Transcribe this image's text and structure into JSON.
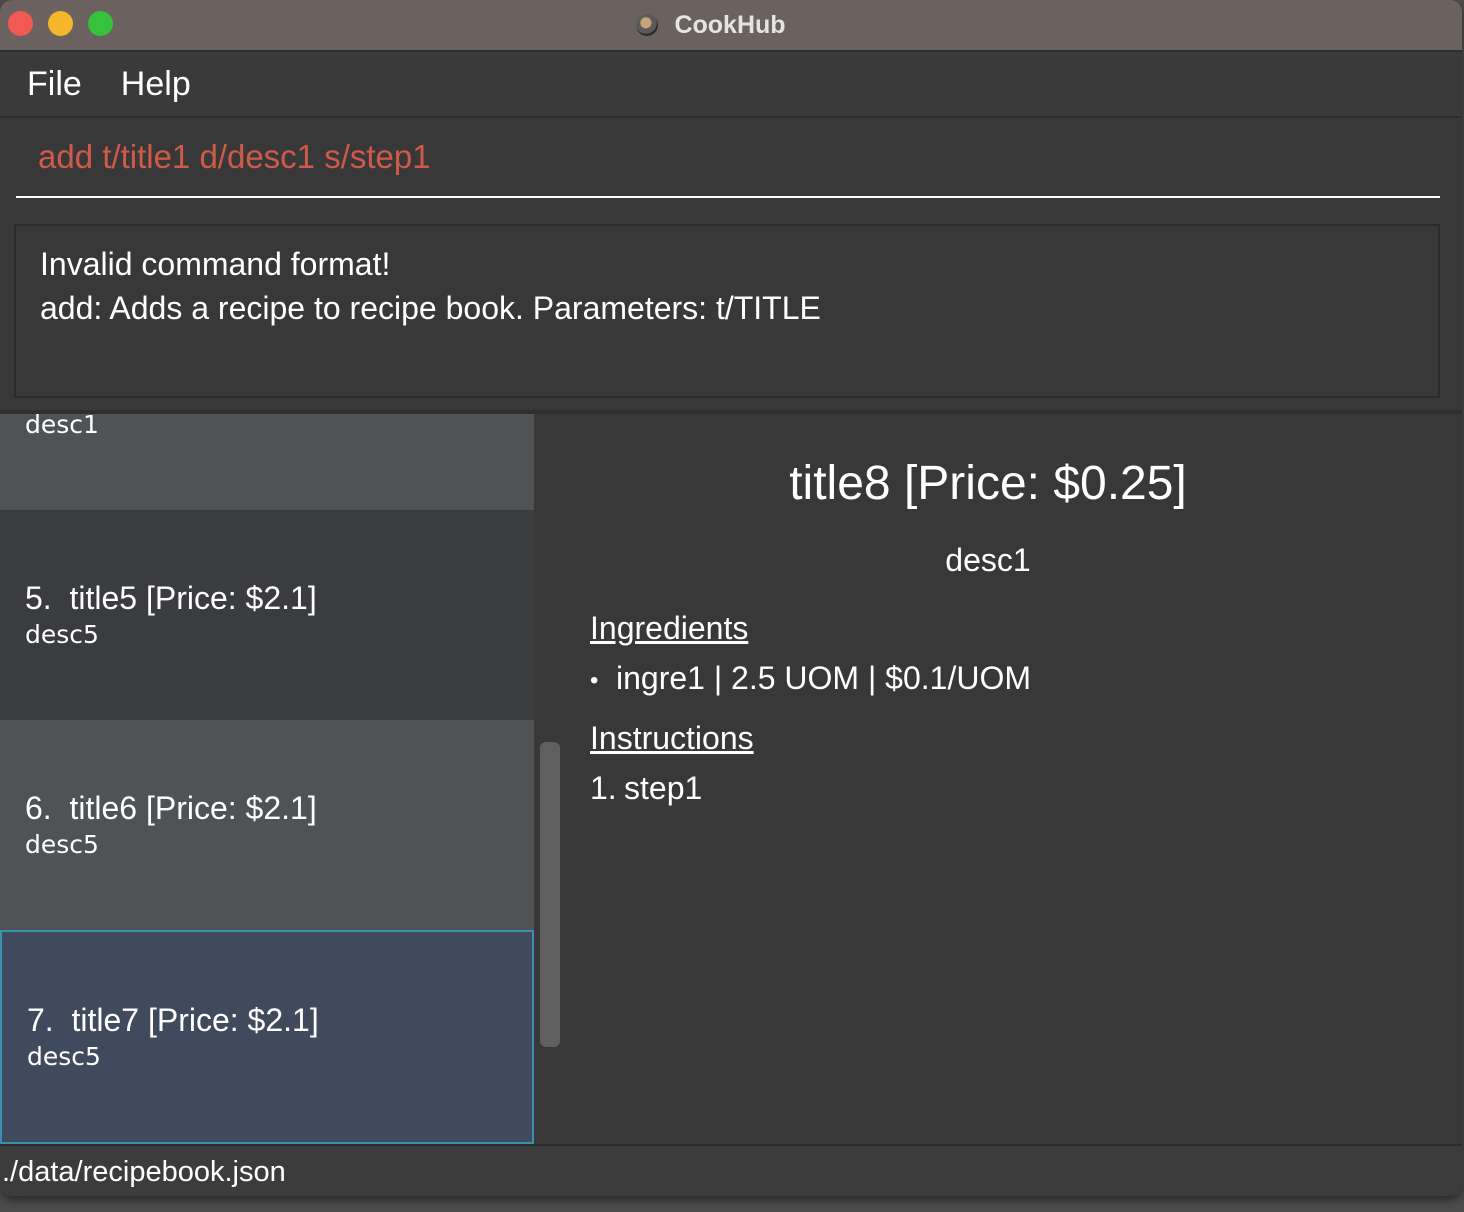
{
  "window": {
    "title": "CookHub"
  },
  "menu": {
    "file": "File",
    "help": "Help"
  },
  "command": {
    "value": "add t/title1 d/desc1 s/step1"
  },
  "result": {
    "line1": "Invalid command format!",
    "line2": "add: Adds a recipe to recipe book. Parameters: t/TITLE"
  },
  "recipe_list": [
    {
      "index": "",
      "title": "",
      "desc": "desc1"
    },
    {
      "index": "5.",
      "title": "title5 [Price: $2.1]",
      "desc": "desc5"
    },
    {
      "index": "6.",
      "title": "title6 [Price: $2.1]",
      "desc": "desc5"
    },
    {
      "index": "7.",
      "title": "title7 [Price: $2.1]",
      "desc": "desc5"
    }
  ],
  "detail": {
    "title": "title8 [Price: $0.25]",
    "description": "desc1",
    "ingredients_heading": "Ingredients",
    "ingredients": [
      "ingre1 | 2.5 UOM | $0.1/UOM"
    ],
    "instructions_heading": "Instructions",
    "instructions": [
      {
        "num": "1.",
        "text": "step1"
      }
    ]
  },
  "status": {
    "path": "./data/recipebook.json"
  }
}
